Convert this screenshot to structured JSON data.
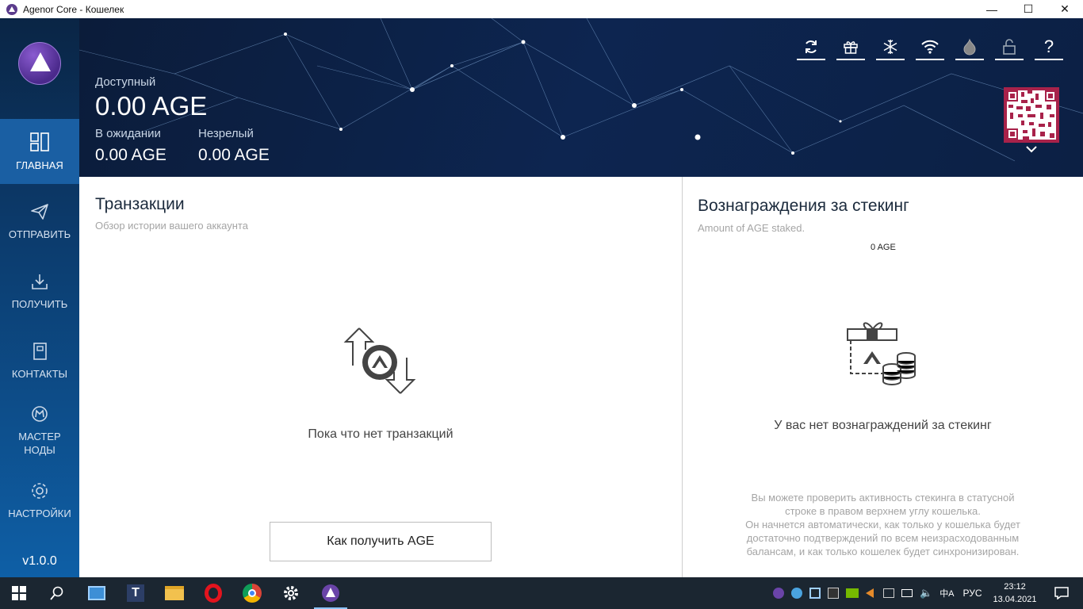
{
  "window": {
    "title": "Agenor Core - Кошелек",
    "controls": {
      "minimize": "—",
      "maximize": "☐",
      "close": "✕"
    }
  },
  "sidebar": {
    "items": [
      {
        "label": "ГЛАВНАЯ",
        "icon": "overview-icon",
        "active": true
      },
      {
        "label": "ОТПРАВИТЬ",
        "icon": "send-icon"
      },
      {
        "label": "ПОЛУЧИТЬ",
        "icon": "receive-icon"
      },
      {
        "label": "КОНТАКТЫ",
        "icon": "contacts-icon"
      },
      {
        "label": "МАСТЕР НОДЫ",
        "icon": "masternode-icon"
      },
      {
        "label": "НАСТРОЙКИ",
        "icon": "settings-icon"
      }
    ],
    "version": "v1.0.0"
  },
  "header": {
    "available_label": "Доступный",
    "available_value": "0.00 AGE",
    "pending_label": "В ожидании",
    "pending_value": "0.00 AGE",
    "immature_label": "Незрелый",
    "immature_value": "0.00 AGE",
    "help_label": "?",
    "status_icons": [
      "sync-icon",
      "gift-icon",
      "snowflake-icon",
      "wifi-icon",
      "tor-icon",
      "unlock-icon",
      "help-icon"
    ]
  },
  "transactions": {
    "title": "Транзакции",
    "subtitle": "Обзор истории вашего аккаунта",
    "empty": "Пока что нет транзакций",
    "how_to_button": "Как получить AGE"
  },
  "staking": {
    "title": "Вознаграждения за стекинг",
    "subtitle": "Amount of AGE staked.",
    "amount": "0 AGE",
    "empty": "У вас нет вознаграждений за стекинг",
    "note_lines": [
      "Вы можете проверить активность стекинга в статусной",
      "строке в правом верхнем углу кошелька.",
      "Он начнется автоматически, как только у кошелька будет",
      "достаточно подтверждений по всем неизрасходованным",
      "балансам, и как только кошелек будет синхронизирован."
    ]
  },
  "taskbar": {
    "language": "РУС",
    "time": "23:12",
    "date": "13.04.2021"
  },
  "colors": {
    "sidebar_top": "#0a2545",
    "sidebar_bottom": "#0e5fa6",
    "qr_bg": "#a8224a",
    "taskbar": "#1b2631"
  }
}
